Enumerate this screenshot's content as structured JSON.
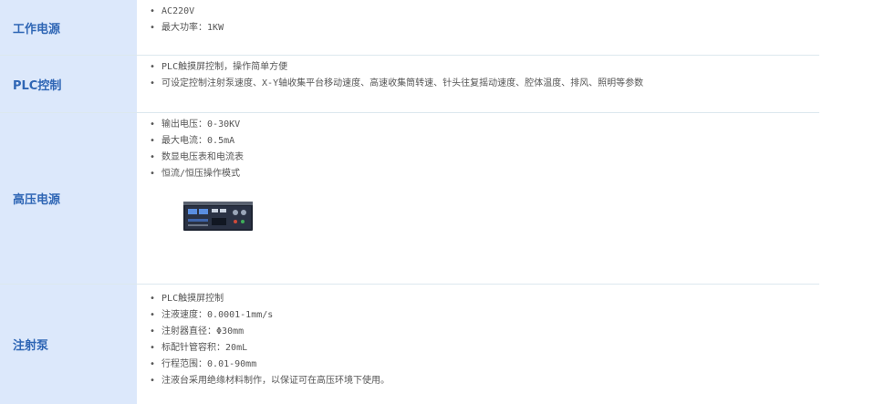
{
  "sections": [
    {
      "label": "工作电源",
      "items": [
        "AC220V",
        "最大功率：1KW"
      ]
    },
    {
      "label": "PLC控制",
      "items": [
        "PLC触摸屏控制，操作简单方便",
        "可设定控制注射泵速度、X-Y轴收集平台移动速度、高速收集筒转速、针头往复摇动速度、腔体温度、排风、照明等参数"
      ]
    },
    {
      "label": "高压电源",
      "items": [
        "输出电压：0-30KV",
        "最大电流：0.5mA",
        "数显电压表和电流表",
        "恒流/恒压操作模式"
      ],
      "image": "high-voltage-power-supply-unit"
    },
    {
      "label": "注射泵",
      "items": [
        "PLC触摸屏控制",
        "注液速度：0.0001-1mm/s",
        "注射器直径：Φ30mm",
        "标配针管容积：20mL",
        "行程范围：0.01-90mm",
        "注液台采用绝缘材料制作，以保证可在高压环境下使用。"
      ]
    }
  ],
  "colors": {
    "label_bg": "#dce8fb",
    "label_text": "#2f66b5",
    "body_text": "#555555",
    "divider": "#dce8ee"
  }
}
